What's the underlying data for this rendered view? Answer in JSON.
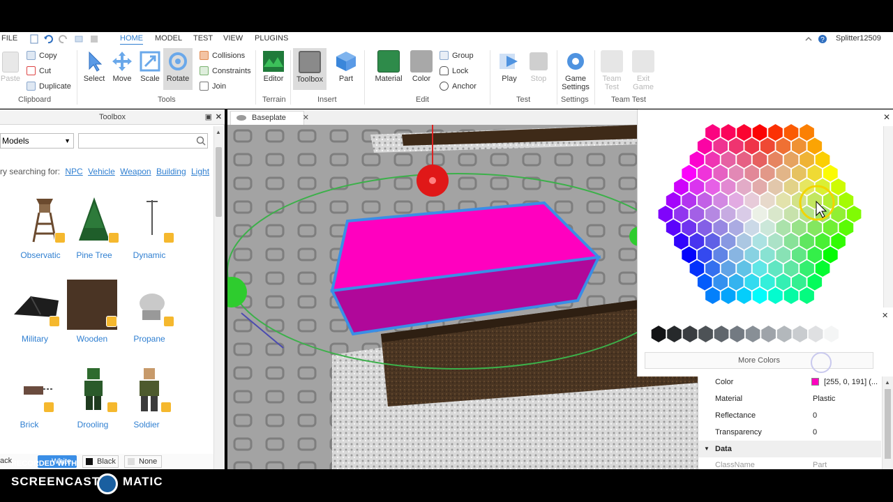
{
  "menubar": {
    "file": "FILE",
    "tabs": [
      "HOME",
      "MODEL",
      "TEST",
      "VIEW",
      "PLUGINS"
    ],
    "active_tab": "HOME",
    "username": "Splitter12509"
  },
  "ribbon": {
    "clipboard": {
      "paste": "Paste",
      "copy": "Copy",
      "cut": "Cut",
      "duplicate": "Duplicate",
      "group_label": "Clipboard"
    },
    "tools": {
      "select": "Select",
      "move": "Move",
      "scale": "Scale",
      "rotate": "Rotate",
      "collisions": "Collisions",
      "constraints": "Constraints",
      "join": "Join",
      "group_label": "Tools"
    },
    "terrain": {
      "editor": "Editor",
      "group_label": "Terrain"
    },
    "insert": {
      "toolbox": "Toolbox",
      "part": "Part",
      "group_label": "Insert"
    },
    "edit": {
      "material": "Material",
      "color": "Color",
      "group": "Group",
      "lock": "Lock",
      "anchor": "Anchor",
      "group_label": "Edit"
    },
    "test": {
      "play": "Play",
      "stop": "Stop",
      "group_label": "Test"
    },
    "settings": {
      "game_settings_1": "Game",
      "game_settings_2": "Settings",
      "group_label": "Settings"
    },
    "team_test": {
      "team_test_1": "Team",
      "team_test_2": "Test",
      "exit_game_1": "Exit",
      "exit_game_2": "Game",
      "group_label": "Team Test"
    }
  },
  "toolbox": {
    "title": "Toolbox",
    "category": "Models",
    "search_placeholder": "",
    "suggest_prefix": "ry searching for:",
    "suggestions": [
      "NPC",
      "Vehicle",
      "Weapon",
      "Building",
      "Light"
    ],
    "models": [
      {
        "label": "Observatic",
        "icon": "watchtower-icon"
      },
      {
        "label": "Pine Tree",
        "icon": "pine-tree-icon"
      },
      {
        "label": "Dynamic",
        "icon": "lamp-post-icon"
      },
      {
        "label": "Military",
        "icon": "military-tent-icon"
      },
      {
        "label": "Wooden",
        "icon": "wooden-crate-icon"
      },
      {
        "label": "Propane",
        "icon": "propane-tank-icon"
      },
      {
        "label": "Brick",
        "icon": "brick-icon"
      },
      {
        "label": "Drooling",
        "icon": "zombie-icon"
      },
      {
        "label": "Soldier",
        "icon": "soldier-icon"
      }
    ],
    "bottom": {
      "white": "White",
      "black": "Black",
      "none": "None",
      "left_text": "ack"
    }
  },
  "viewport": {
    "tab_label": "Baseplate"
  },
  "picker": {
    "more_colors": "More Colors"
  },
  "properties": {
    "rows": [
      {
        "name": "Color",
        "value": "[255, 0, 191] (..."
      },
      {
        "name": "Material",
        "value": "Plastic"
      },
      {
        "name": "Reflectance",
        "value": "0"
      },
      {
        "name": "Transparency",
        "value": "0"
      }
    ],
    "section": "Data",
    "classname_label": "ClassName",
    "classname_value": "Part",
    "swatch_color": "#ff00bf"
  },
  "watermark": {
    "recorded": "RECORDED WITH",
    "brand_left": "SCREENCAST",
    "brand_right": "MATIC"
  },
  "colors": {
    "accent": "#2f7fd1",
    "part_pink": "#ff00bf",
    "selection_blue": "#3a8ee6"
  }
}
